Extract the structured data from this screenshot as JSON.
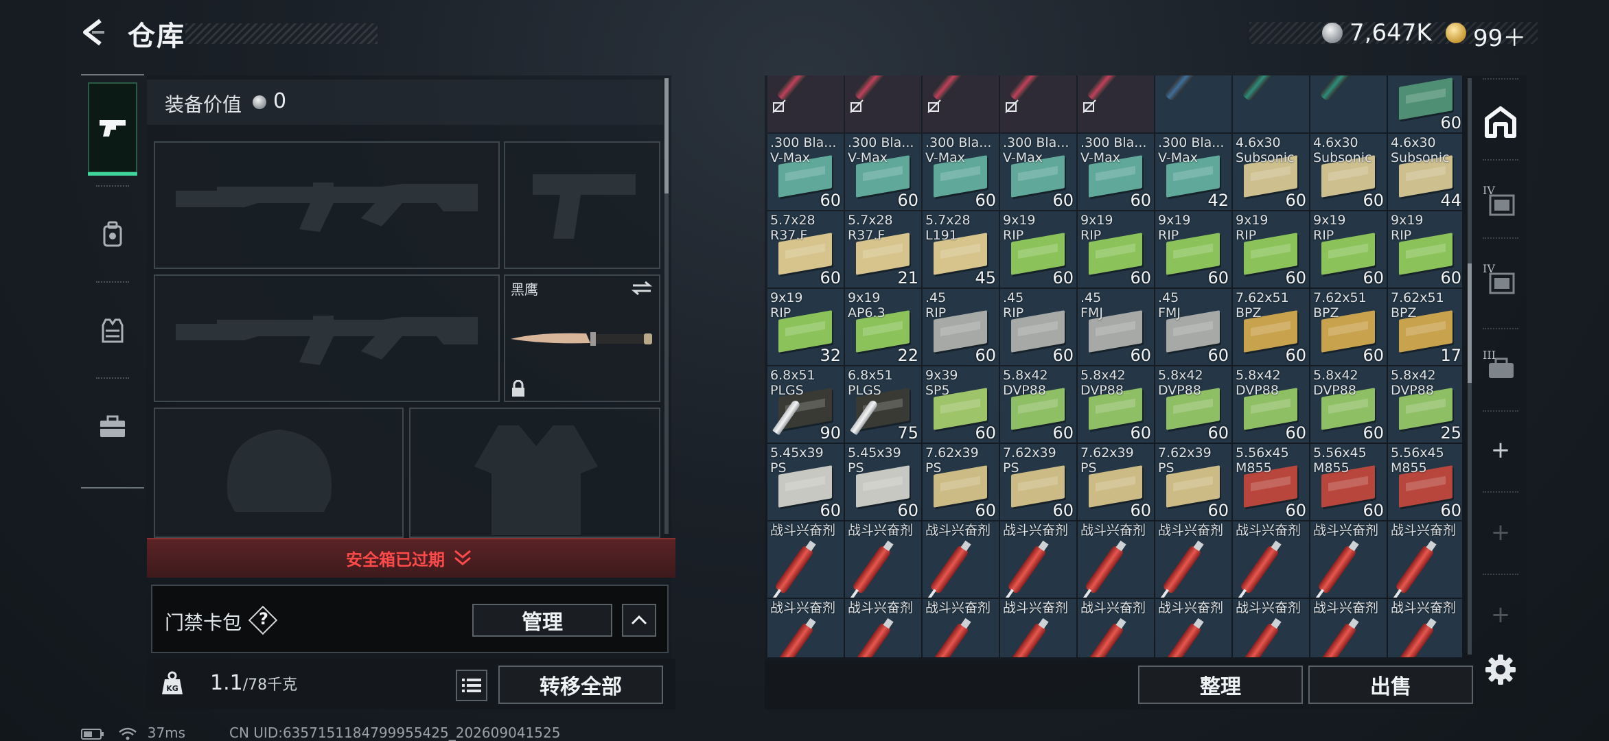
{
  "header": {
    "title": "仓库",
    "currency_silver": "7,647K",
    "currency_gold": "99＋"
  },
  "tabs": [
    {
      "icon": "pistol-icon",
      "active": true
    },
    {
      "icon": "backpack-icon",
      "active": false
    },
    {
      "icon": "vest-icon",
      "active": false
    },
    {
      "icon": "briefcase-icon",
      "active": false
    }
  ],
  "equipment": {
    "value_label": "装备价值",
    "value": "0",
    "knife_name": "黑鹰",
    "safe_box_status": "安全箱已过期",
    "key_bag_label": "门禁卡包",
    "help_mark": "?",
    "manage_label": "管理",
    "weight_current": "1.1",
    "weight_max": "/78",
    "weight_unit": "千克",
    "transfer_all_label": "转移全部"
  },
  "inventory": {
    "items": [
      {
        "name": "",
        "count": "",
        "type": "grenade",
        "color": "#c0405a"
      },
      {
        "name": "",
        "count": "",
        "type": "grenade",
        "color": "#c0405a"
      },
      {
        "name": "",
        "count": "",
        "type": "grenade",
        "color": "#c0405a"
      },
      {
        "name": "",
        "count": "",
        "type": "grenade",
        "color": "#c0405a"
      },
      {
        "name": "",
        "count": "",
        "type": "grenade",
        "color": "#c0405a"
      },
      {
        "name": "",
        "count": "",
        "type": "grenade",
        "color": "#3e6f9a"
      },
      {
        "name": "",
        "count": "",
        "type": "grenade",
        "color": "#2f8d7a"
      },
      {
        "name": "",
        "count": "",
        "type": "grenade",
        "color": "#2f8d7a"
      },
      {
        "name": "",
        "count": "60",
        "type": "box",
        "color": "#4f8f74"
      },
      {
        "name": ".300 Bla...\nV-Max",
        "count": "60",
        "type": "box",
        "color": "#5fa89a"
      },
      {
        "name": ".300 Bla...\nV-Max",
        "count": "60",
        "type": "box",
        "color": "#5fa89a"
      },
      {
        "name": ".300 Bla...\nV-Max",
        "count": "60",
        "type": "box",
        "color": "#5fa89a"
      },
      {
        "name": ".300 Bla...\nV-Max",
        "count": "60",
        "type": "box",
        "color": "#5fa89a"
      },
      {
        "name": ".300 Bla...\nV-Max",
        "count": "60",
        "type": "box",
        "color": "#5fa89a"
      },
      {
        "name": ".300 Bla...\nV-Max",
        "count": "42",
        "type": "box",
        "color": "#5fa89a"
      },
      {
        "name": "4.6x30\nSubsonic",
        "count": "60",
        "type": "box",
        "color": "#cdbf8e"
      },
      {
        "name": "4.6x30\nSubsonic",
        "count": "60",
        "type": "box",
        "color": "#cdbf8e"
      },
      {
        "name": "4.6x30\nSubsonic",
        "count": "44",
        "type": "box",
        "color": "#cdbf8e"
      },
      {
        "name": "5.7x28\nR37.F",
        "count": "60",
        "type": "box",
        "color": "#d6c48c"
      },
      {
        "name": "5.7x28\nR37.F",
        "count": "21",
        "type": "box",
        "color": "#d6c48c"
      },
      {
        "name": "5.7x28\nL191",
        "count": "45",
        "type": "box",
        "color": "#d6c48c"
      },
      {
        "name": "9x19\nRIP",
        "count": "60",
        "type": "box",
        "color": "#8cc25a"
      },
      {
        "name": "9x19\nRIP",
        "count": "60",
        "type": "box",
        "color": "#8cc25a"
      },
      {
        "name": "9x19\nRIP",
        "count": "60",
        "type": "box",
        "color": "#8cc25a"
      },
      {
        "name": "9x19\nRIP",
        "count": "60",
        "type": "box",
        "color": "#8cc25a"
      },
      {
        "name": "9x19\nRIP",
        "count": "60",
        "type": "box",
        "color": "#8cc25a"
      },
      {
        "name": "9x19\nRIP",
        "count": "60",
        "type": "box",
        "color": "#8cc25a"
      },
      {
        "name": "9x19\nRIP",
        "count": "32",
        "type": "box",
        "color": "#8cc25a"
      },
      {
        "name": "9x19\nAP6.3",
        "count": "22",
        "type": "box",
        "color": "#8cc25a"
      },
      {
        "name": ".45\nRIP",
        "count": "60",
        "type": "box",
        "color": "#a7a9a6"
      },
      {
        "name": ".45\nRIP",
        "count": "60",
        "type": "box",
        "color": "#a7a9a6"
      },
      {
        "name": ".45\nFMJ",
        "count": "60",
        "type": "box",
        "color": "#a7a9a6"
      },
      {
        "name": ".45\nFMJ",
        "count": "60",
        "type": "box",
        "color": "#a7a9a6"
      },
      {
        "name": "7.62x51\nBPZ",
        "count": "60",
        "type": "box",
        "color": "#c9a24e"
      },
      {
        "name": "7.62x51\nBPZ",
        "count": "60",
        "type": "box",
        "color": "#c9a24e"
      },
      {
        "name": "7.62x51\nBPZ",
        "count": "17",
        "type": "box",
        "color": "#c9a24e"
      },
      {
        "name": "6.8x51\nPLGS",
        "count": "90",
        "type": "bullet",
        "color": "#3a3a34"
      },
      {
        "name": "6.8x51\nPLGS",
        "count": "75",
        "type": "bullet",
        "color": "#3a3a34"
      },
      {
        "name": "9x39\nSP5",
        "count": "60",
        "type": "box",
        "color": "#9ec46a"
      },
      {
        "name": "5.8x42\nDVP88",
        "count": "60",
        "type": "box",
        "color": "#8fbf64"
      },
      {
        "name": "5.8x42\nDVP88",
        "count": "60",
        "type": "box",
        "color": "#8fbf64"
      },
      {
        "name": "5.8x42\nDVP88",
        "count": "60",
        "type": "box",
        "color": "#8fbf64"
      },
      {
        "name": "5.8x42\nDVP88",
        "count": "60",
        "type": "box",
        "color": "#8fbf64"
      },
      {
        "name": "5.8x42\nDVP88",
        "count": "60",
        "type": "box",
        "color": "#8fbf64"
      },
      {
        "name": "5.8x42\nDVP88",
        "count": "25",
        "type": "box",
        "color": "#8fbf64"
      },
      {
        "name": "5.45x39\nPS",
        "count": "60",
        "type": "box",
        "color": "#c8c8c2"
      },
      {
        "name": "5.45x39\nPS",
        "count": "60",
        "type": "box",
        "color": "#c8c8c2"
      },
      {
        "name": "7.62x39\nPS",
        "count": "60",
        "type": "box",
        "color": "#cdbb86"
      },
      {
        "name": "7.62x39\nPS",
        "count": "60",
        "type": "box",
        "color": "#cdbb86"
      },
      {
        "name": "7.62x39\nPS",
        "count": "60",
        "type": "box",
        "color": "#cdbb86"
      },
      {
        "name": "7.62x39\nPS",
        "count": "60",
        "type": "box",
        "color": "#cdbb86"
      },
      {
        "name": "5.56x45\nM855",
        "count": "60",
        "type": "box",
        "color": "#b8463c"
      },
      {
        "name": "5.56x45\nM855",
        "count": "60",
        "type": "box",
        "color": "#b8463c"
      },
      {
        "name": "5.56x45\nM855",
        "count": "60",
        "type": "box",
        "color": "#b8463c"
      },
      {
        "name": "战斗兴奋剂",
        "count": "",
        "type": "syringe",
        "color": "#e6584e"
      },
      {
        "name": "战斗兴奋剂",
        "count": "",
        "type": "syringe",
        "color": "#e6584e"
      },
      {
        "name": "战斗兴奋剂",
        "count": "",
        "type": "syringe",
        "color": "#e6584e"
      },
      {
        "name": "战斗兴奋剂",
        "count": "",
        "type": "syringe",
        "color": "#e6584e"
      },
      {
        "name": "战斗兴奋剂",
        "count": "",
        "type": "syringe",
        "color": "#e6584e"
      },
      {
        "name": "战斗兴奋剂",
        "count": "",
        "type": "syringe",
        "color": "#e6584e"
      },
      {
        "name": "战斗兴奋剂",
        "count": "",
        "type": "syringe",
        "color": "#e6584e"
      },
      {
        "name": "战斗兴奋剂",
        "count": "",
        "type": "syringe",
        "color": "#e6584e"
      },
      {
        "name": "战斗兴奋剂",
        "count": "",
        "type": "syringe",
        "color": "#e6584e"
      },
      {
        "name": "战斗兴奋剂",
        "count": "",
        "type": "syringe",
        "color": "#e6584e"
      },
      {
        "name": "战斗兴奋剂",
        "count": "",
        "type": "syringe",
        "color": "#e6584e"
      },
      {
        "name": "战斗兴奋剂",
        "count": "",
        "type": "syringe",
        "color": "#e6584e"
      },
      {
        "name": "战斗兴奋剂",
        "count": "",
        "type": "syringe",
        "color": "#e6584e"
      },
      {
        "name": "战斗兴奋剂",
        "count": "",
        "type": "syringe",
        "color": "#e6584e"
      },
      {
        "name": "战斗兴奋剂",
        "count": "",
        "type": "syringe",
        "color": "#e6584e"
      },
      {
        "name": "战斗兴奋剂",
        "count": "",
        "type": "syringe",
        "color": "#e6584e"
      },
      {
        "name": "战斗兴奋剂",
        "count": "",
        "type": "syringe",
        "color": "#e6584e"
      },
      {
        "name": "战斗兴奋剂",
        "count": "",
        "type": "syringe",
        "color": "#e6584e"
      }
    ],
    "sort_label": "整理",
    "sell_label": "出售"
  },
  "rail": {
    "tier_1": "IV",
    "tier_2": "IV",
    "tier_3": "III",
    "plus": "+"
  },
  "status": {
    "ping": "37ms",
    "uid": "CN UID:6357151184799955425_202609041525"
  },
  "colors": {
    "accent_green": "#3ed69a",
    "warning_red": "#ff4a4a"
  }
}
